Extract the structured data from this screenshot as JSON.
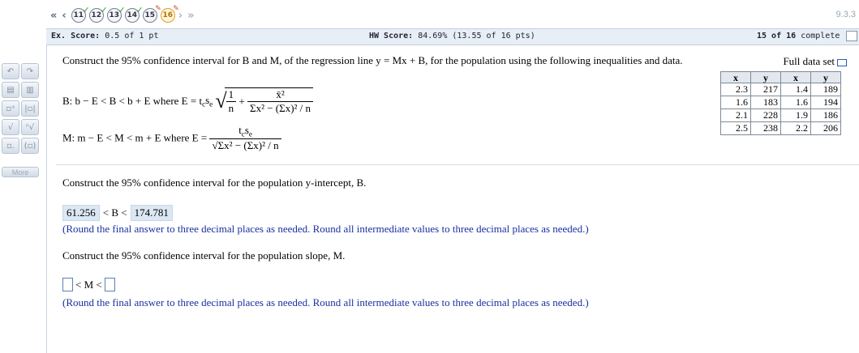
{
  "nav": {
    "first_arrow": "«",
    "prev_arrow": "‹",
    "next_arrow": "›",
    "last_arrow": "»",
    "questions": [
      {
        "number": "11",
        "status": "correct"
      },
      {
        "number": "12",
        "status": "correct"
      },
      {
        "number": "13",
        "status": "correct"
      },
      {
        "number": "14",
        "status": "correct"
      },
      {
        "number": "15",
        "status": "partial"
      },
      {
        "number": "16",
        "status": "current"
      }
    ],
    "version": "9.3.3"
  },
  "scores": {
    "ex_score_label": "Ex. Score:",
    "ex_score_value": "0.5 of 1 pt",
    "hw_score_label": "HW Score:",
    "hw_score_value": "84.69% (13.55 of 16 pts)",
    "progress_count": "15 of 16",
    "progress_label": "complete"
  },
  "tools": {
    "more_label": "More"
  },
  "question": {
    "intro": "Construct the 95% confidence interval for B and M, of the regression line y = Mx + B, for the population using the following inequalities and data.",
    "b_formula_prefix": "B: b − E < B < b + E where E = t",
    "m_formula_prefix": "M: m − E < M < m + E where E =",
    "sub_c": "c",
    "sub_e": "e",
    "s_letter": "s",
    "one": "1",
    "n": "n",
    "xbar_sq": "x̄²",
    "sum_expr": "Σx² − (Σx)² / n",
    "plus": "+",
    "tc": "t",
    "full_data_label": "Full data set",
    "table_headers": [
      "x",
      "y",
      "x",
      "y"
    ],
    "table_rows": [
      [
        "2.3",
        "217",
        "1.4",
        "189"
      ],
      [
        "1.6",
        "183",
        "1.6",
        "194"
      ],
      [
        "2.1",
        "228",
        "1.9",
        "186"
      ],
      [
        "2.5",
        "238",
        "2.2",
        "206"
      ]
    ],
    "part1_prompt": "Construct the 95% confidence interval for the population y-intercept, B.",
    "part1_lower": "61.256",
    "part1_mid": "< B <",
    "part1_upper": "174.781",
    "rounding_note": "(Round the final answer to three decimal places as needed. Round all intermediate values to three decimal places as needed.)",
    "part2_prompt": "Construct the 95% confidence interval for the population slope, M.",
    "part2_mid": "< M <",
    "part2_lower_value": "",
    "part2_upper_value": ""
  }
}
